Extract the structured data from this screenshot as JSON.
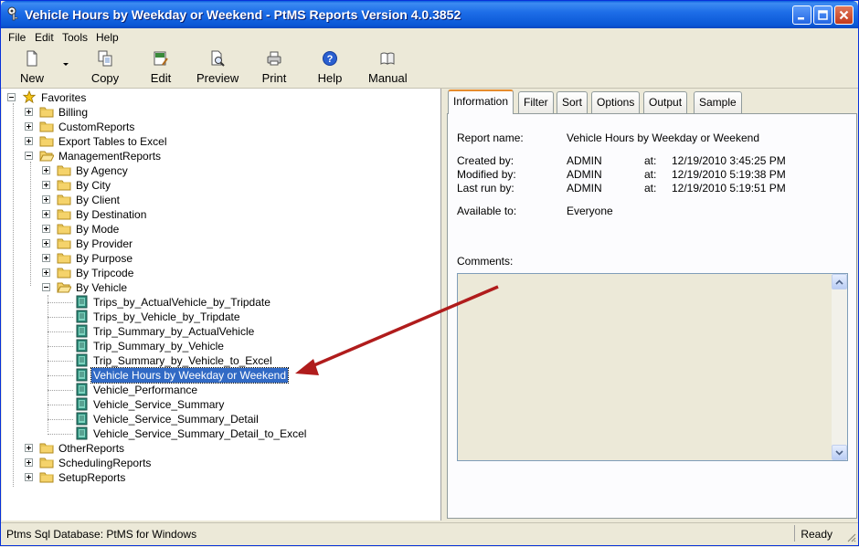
{
  "window": {
    "title": "Vehicle Hours by Weekday or Weekend - PtMS Reports Version 4.0.3852"
  },
  "menu": [
    "File",
    "Edit",
    "Tools",
    "Help"
  ],
  "toolbar": {
    "new": "New",
    "copy": "Copy",
    "edit": "Edit",
    "preview": "Preview",
    "print": "Print",
    "help": "Help",
    "manual": "Manual"
  },
  "tree": {
    "root": "Favorites",
    "top_folders": [
      "Billing",
      "CustomReports",
      "Export Tables to Excel",
      "ManagementReports"
    ],
    "management_children": [
      "By Agency",
      "By City",
      "By Client",
      "By Destination",
      "By Mode",
      "By Provider",
      "By Purpose",
      "By Tripcode",
      "By Vehicle"
    ],
    "vehicle_reports": [
      "Trips_by_ActualVehicle_by_Tripdate",
      "Trips_by_Vehicle_by_Tripdate",
      "Trip_Summary_by_ActualVehicle",
      "Trip_Summary_by_Vehicle",
      "Trip_Summary_by_Vehicle_to_Excel",
      "Vehicle Hours by Weekday or Weekend",
      "Vehicle_Performance",
      "Vehicle_Service_Summary",
      "Vehicle_Service_Summary_Detail",
      "Vehicle_Service_Summary_Detail_to_Excel"
    ],
    "bottom_folders": [
      "OtherReports",
      "SchedulingReports",
      "SetupReports"
    ]
  },
  "tabs": [
    "Information",
    "Filter",
    "Sort",
    "Options",
    "Output",
    "Sample"
  ],
  "info": {
    "report_name_label": "Report name:",
    "report_name": "Vehicle Hours by Weekday or Weekend",
    "created_label": "Created by:",
    "created_by": "ADMIN",
    "created_at_label": "at:",
    "created_at": "12/19/2010 3:45:25 PM",
    "modified_label": "Modified by:",
    "modified_by": "ADMIN",
    "modified_at_label": "at:",
    "modified_at": "12/19/2010 5:19:38 PM",
    "lastrun_label": "Last run by:",
    "lastrun_by": "ADMIN",
    "lastrun_at_label": "at:",
    "lastrun_at": "12/19/2010 5:19:51 PM",
    "available_label": "Available to:",
    "available": "Everyone",
    "comments_label": "Comments:"
  },
  "status": {
    "left": "Ptms Sql Database: PtMS for Windows",
    "right": "Ready"
  },
  "colors": {
    "title_bar": "#0a5fde",
    "selection": "#316ac5",
    "annotation_arrow": "#b01c1c",
    "folder": "#f5d36b"
  }
}
